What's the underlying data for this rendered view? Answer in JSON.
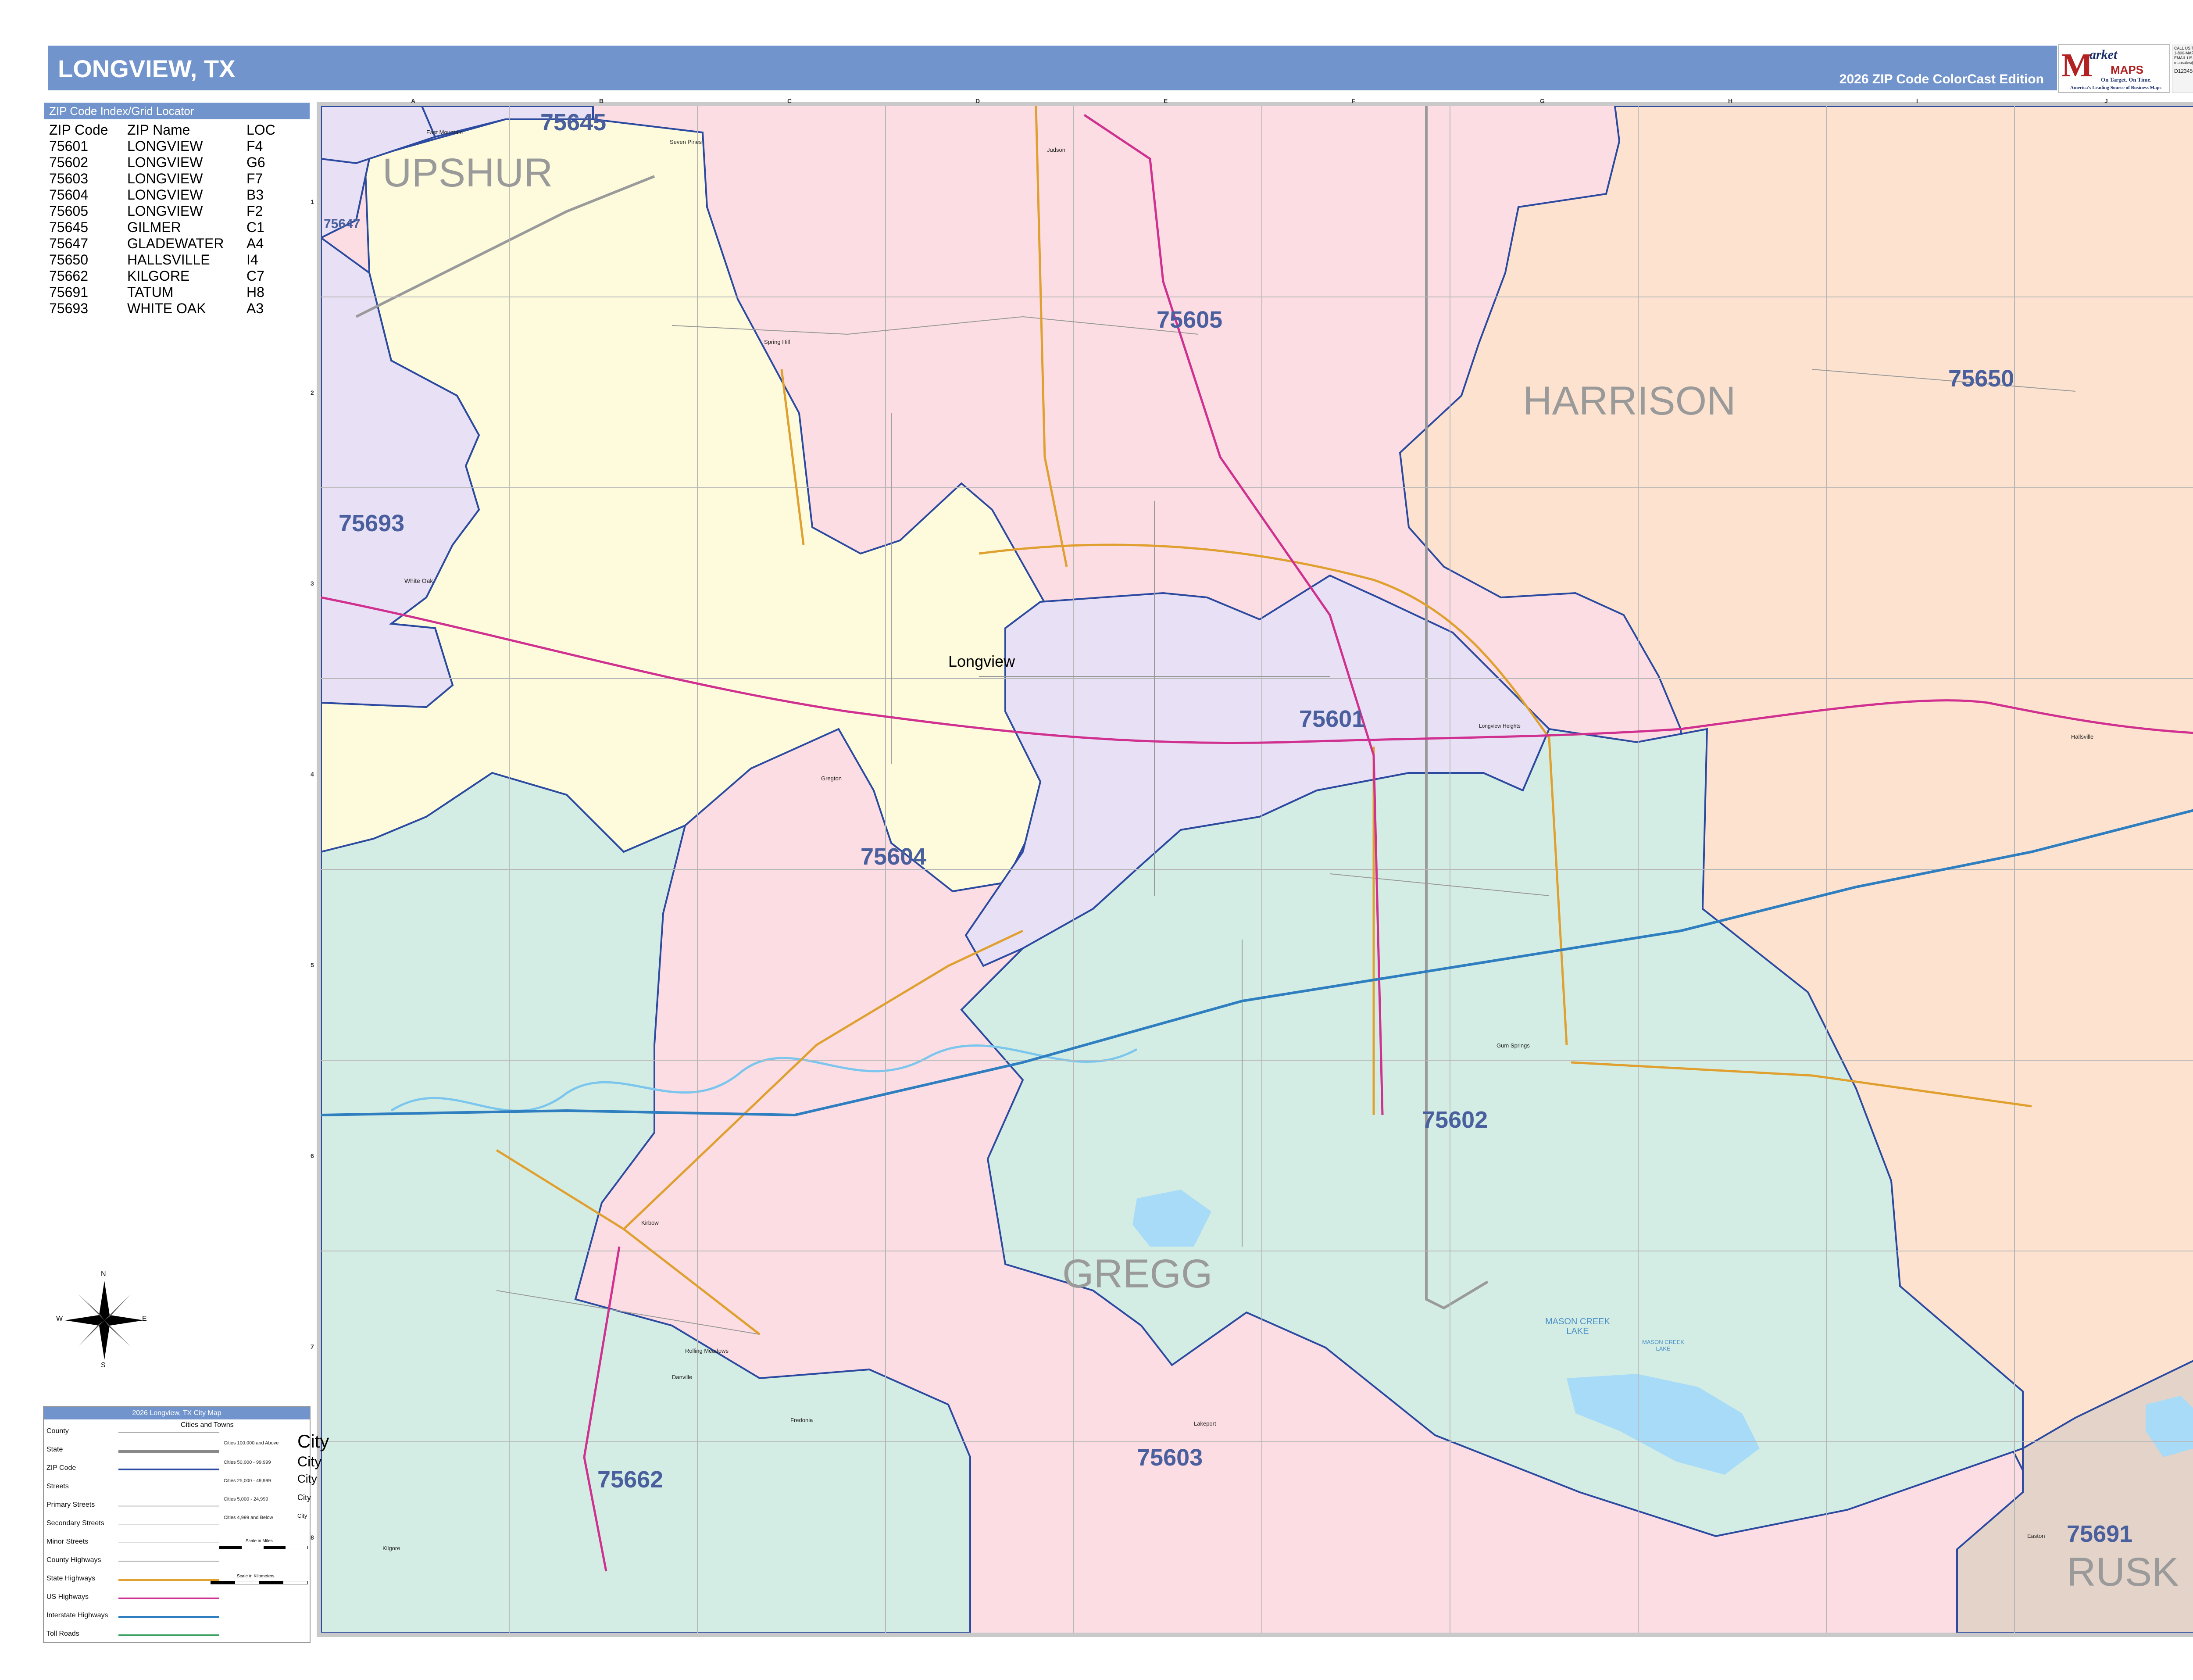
{
  "header": {
    "title": "LONGVIEW, TX",
    "edition": "2026 ZIP Code ColorCast Edition"
  },
  "logo": {
    "mark": "M",
    "word1": "arket",
    "word2": "MAPS",
    "tagline": "On Target. On Time.",
    "subtitle": "America's Leading Source of Business Maps",
    "side_lines": [
      "CALL US TOLL FREE",
      "1-800-MAP-SHOP",
      "EMAIL US AT",
      "mapsales@marketmaps.com"
    ],
    "item_number": "D123456"
  },
  "zip_index": {
    "heading": "ZIP Code Index/Grid Locator",
    "columns": [
      "ZIP Code",
      "ZIP Name",
      "LOC"
    ],
    "rows": [
      [
        "75601",
        "LONGVIEW",
        "F4"
      ],
      [
        "75602",
        "LONGVIEW",
        "G6"
      ],
      [
        "75603",
        "LONGVIEW",
        "F7"
      ],
      [
        "75604",
        "LONGVIEW",
        "B3"
      ],
      [
        "75605",
        "LONGVIEW",
        "F2"
      ],
      [
        "75645",
        "GILMER",
        "C1"
      ],
      [
        "75647",
        "GLADEWATER",
        "A4"
      ],
      [
        "75650",
        "HALLSVILLE",
        "I4"
      ],
      [
        "75662",
        "KILGORE",
        "C7"
      ],
      [
        "75691",
        "TATUM",
        "H8"
      ],
      [
        "75693",
        "WHITE OAK",
        "A3"
      ]
    ]
  },
  "map": {
    "grid_columns": [
      "A",
      "B",
      "C",
      "D",
      "E",
      "F",
      "G",
      "H",
      "I",
      "J"
    ],
    "grid_rows": [
      "1",
      "2",
      "3",
      "4",
      "5",
      "6",
      "7",
      "8"
    ],
    "counties": [
      "UPSHUR",
      "HARRISON",
      "GREGG",
      "RUSK"
    ],
    "zip_labels": [
      "75645",
      "75647",
      "75605",
      "75650",
      "75693",
      "75601",
      "75604",
      "75602",
      "75662",
      "75603",
      "75691"
    ],
    "city_label": "Longview",
    "towns": [
      "East Mountain",
      "Seven Pines",
      "Judson",
      "Spring Hill",
      "White Oak",
      "Gregton",
      "Longview Heights",
      "Hallsville",
      "Gum Springs",
      "Kilgore",
      "Kirbow",
      "Danville",
      "Rolling Meadows",
      "Fredonia",
      "Lakeport",
      "Easton"
    ],
    "lake_labels": [
      "MASON CREEK LAKE",
      "MASON CREEK LAKE"
    ],
    "compass_letters": [
      "N",
      "E",
      "S",
      "W"
    ],
    "colors": {
      "pink": "#fbdde3",
      "yellow": "#fdfbdc",
      "lavender": "#e8e0f4",
      "teal": "#d4ede4",
      "peach": "#fde3cf",
      "tan": "#e4d3c9",
      "zip_label": "#4a5f9e",
      "county_label": "#9a9a9a",
      "water": "#a8dbf7"
    }
  },
  "legend": {
    "title": "2026 Longview, TX City Map",
    "items": [
      "County",
      "State",
      "ZIP Code",
      "Streets",
      "Primary Streets",
      "Secondary Streets",
      "Minor Streets",
      "County Highways",
      "State Highways",
      "US Highways",
      "Interstate Highways",
      "Toll Roads"
    ],
    "cities_heading": "Cities and Towns",
    "city_classes": [
      "Cities 100,000 and Above",
      "Cities 50,000 - 99,999",
      "Cities 25,000 - 49,999",
      "Cities 5,000 - 24,999",
      "Cities 4,999 and Below"
    ],
    "city_samples": [
      "City",
      "City",
      "City",
      "City",
      "City"
    ],
    "scale_miles": "Scale in Miles",
    "scale_km": "Scale in Kilometers"
  }
}
